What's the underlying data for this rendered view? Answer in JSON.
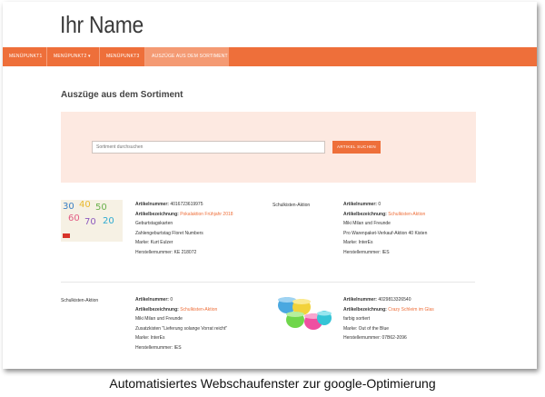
{
  "site": {
    "title": "Ihr Name"
  },
  "nav": {
    "items": [
      {
        "label": "Menüpunkt1"
      },
      {
        "label": "Menüpunkt2 ▾"
      },
      {
        "label": "Menüpunkt3"
      },
      {
        "label": "Auszüge aus dem Sortiment"
      }
    ]
  },
  "page": {
    "heading": "Auszüge aus dem Sortiment"
  },
  "search": {
    "placeholder": "Sortiment durchsuchen",
    "button_label": "Artikel suchen"
  },
  "products": [
    {
      "image": "number-cards",
      "number_label": "Artikelnummer:",
      "number": "4016723619975",
      "name_label": "Artikelbezeichnung:",
      "name": "Pokalaktion Frühjahr 2018",
      "desc1": "Geburtstagskarten",
      "desc2": "Zahlengeburtstag Floret Numbers",
      "brand": "Marke: Kurt Eulzer",
      "mpn": "Herstellernummer: KE 218072"
    },
    {
      "aktion": "Schulkisten-Aktion",
      "number_label": "Artikelnummer:",
      "number": "0",
      "name_label": "Artikelbezeichnung:",
      "name": "Schulkisten-Aktion",
      "desc1": "Miki Milan und Freunde",
      "desc2": "Pro Warenpaket-Verkauf-Aktion 40 Kisten",
      "brand": "Marke: InterEs",
      "mpn": "Herstellernummer: IES"
    },
    {
      "aktion": "Schulkisten-Aktion",
      "number_label": "Artikelnummer:",
      "number": "0",
      "name_label": "Artikelbezeichnung:",
      "name": "Schulkisten-Aktion",
      "desc1": "Miki Milan und Freunde",
      "desc2": "Zusatzkisten \"Lieferung solange Vorrat reicht\"",
      "brand": "Marke: InterEs",
      "mpn": "Herstellernummer: IES"
    },
    {
      "image": "slime-jars",
      "number_label": "Artikelnummer:",
      "number": "4029813326540",
      "name_label": "Artikelbezeichnung:",
      "name": "Crazy Schleim im Glas",
      "desc1": "farbig sortiert",
      "brand": "Marke: Out of the Blue",
      "mpn": "Herstellernummer: 07B62-2096"
    }
  ],
  "caption": "Automatisiertes Webschaufenster zur google-Optimierung",
  "colors": {
    "accent": "#ee6f3a",
    "panel": "#fde9e1",
    "active_tab": "#f49a73"
  }
}
